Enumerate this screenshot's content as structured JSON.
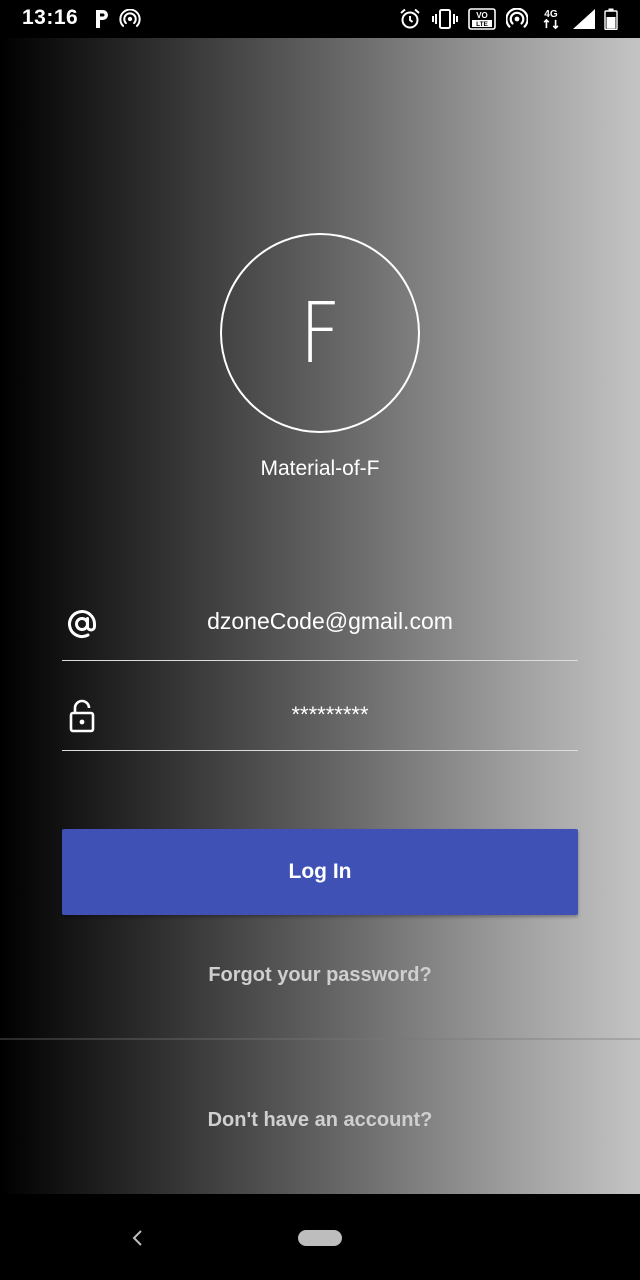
{
  "status_bar": {
    "time": "13:16",
    "left_icons": [
      "parking-icon",
      "hotspot-icon"
    ],
    "right_icons": [
      "alarm-icon",
      "vibrate-icon",
      "volte-icon",
      "hotspot-icon",
      "4g-data-icon",
      "signal-icon",
      "battery-icon"
    ],
    "volte_label_top": "VO",
    "volte_label_bottom": "LTE",
    "network_label": "4G"
  },
  "profile": {
    "avatar_letter": "F",
    "app_name": "Material-of-F"
  },
  "form": {
    "email_value": "dzoneCode@gmail.com",
    "password_value": "*********",
    "login_label": "Log In",
    "forgot_label": "Forgot your password?",
    "signup_label": "Don't have an account?"
  },
  "colors": {
    "accent": "#3f51b5"
  },
  "nav_bar": {
    "icons": [
      "back-icon",
      "home-pill-icon"
    ]
  }
}
